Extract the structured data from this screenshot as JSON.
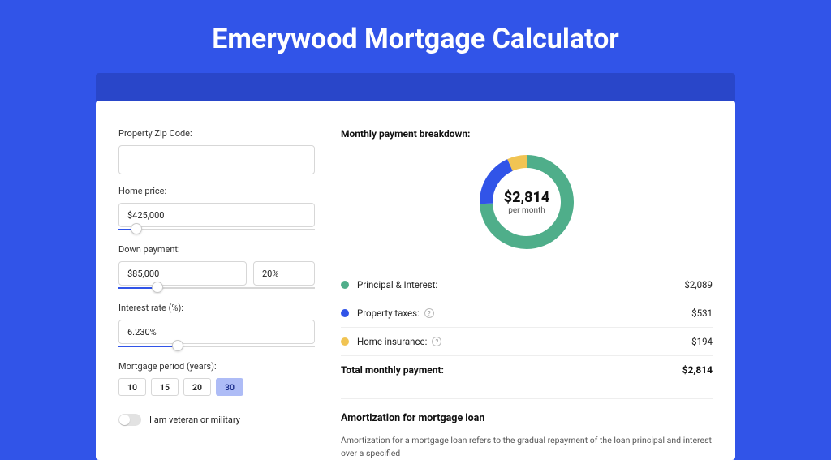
{
  "page": {
    "title": "Emerywood Mortgage Calculator"
  },
  "form": {
    "zip_label": "Property Zip Code:",
    "zip_value": "",
    "home_price_label": "Home price:",
    "home_price_value": "$425,000",
    "home_price_slider_pct": 9,
    "down_payment_label": "Down payment:",
    "down_payment_value": "$85,000",
    "down_payment_pct_value": "20%",
    "down_payment_slider_pct": 20,
    "interest_label": "Interest rate (%):",
    "interest_value": "6.230%",
    "interest_slider_pct": 30,
    "period_label": "Mortgage period (years):",
    "periods": [
      "10",
      "15",
      "20",
      "30"
    ],
    "period_selected": "30",
    "veteran_label": "I am veteran or military"
  },
  "breakdown": {
    "title": "Monthly payment breakdown:",
    "center_value": "$2,814",
    "center_sub": "per month",
    "items": [
      {
        "label": "Principal & Interest:",
        "value": "$2,089",
        "color": "#4fae8a",
        "info": false,
        "numeric": 2089
      },
      {
        "label": "Property taxes:",
        "value": "$531",
        "color": "#3154e8",
        "info": true,
        "numeric": 531
      },
      {
        "label": "Home insurance:",
        "value": "$194",
        "color": "#f1c453",
        "info": true,
        "numeric": 194
      }
    ],
    "total_label": "Total monthly payment:",
    "total_value": "$2,814"
  },
  "amort": {
    "title": "Amortization for mortgage loan",
    "body": "Amortization for a mortgage loan refers to the gradual repayment of the loan principal and interest over a specified"
  },
  "chart_data": {
    "type": "pie",
    "title": "Monthly payment breakdown",
    "series": [
      {
        "name": "Principal & Interest",
        "value": 2089,
        "color": "#4fae8a"
      },
      {
        "name": "Property taxes",
        "value": 531,
        "color": "#3154e8"
      },
      {
        "name": "Home insurance",
        "value": 194,
        "color": "#f1c453"
      }
    ],
    "total": 2814,
    "center_label": "$2,814 per month"
  }
}
